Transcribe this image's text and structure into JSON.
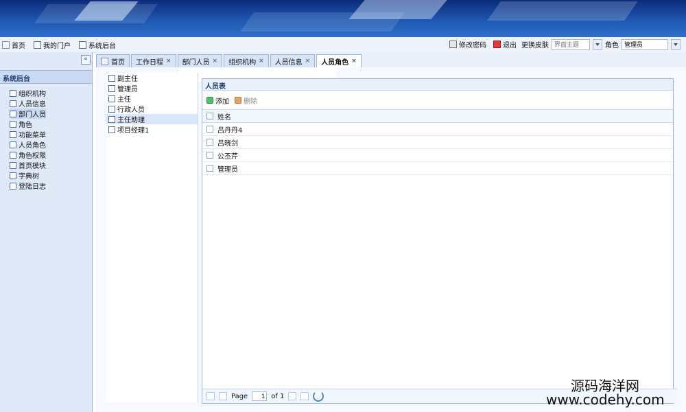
{
  "topbar": {
    "left": [
      {
        "icon": "home-icon",
        "label": "首页"
      },
      {
        "icon": "portal-icon",
        "label": "我的门户"
      },
      {
        "icon": "admin-icon",
        "label": "系统后台"
      }
    ],
    "right": {
      "change_password": "修改密码",
      "logout": "退出",
      "skin_label": "更换皮肤",
      "skin_placeholder": "界面主题",
      "role_label": "角色",
      "role_value": "管理员"
    }
  },
  "leftnav": {
    "collapse_symbol": "«",
    "title": "系统后台",
    "items": [
      {
        "label": "组织机构"
      },
      {
        "label": "人员信息"
      },
      {
        "label": "部门人员"
      },
      {
        "label": "角色"
      },
      {
        "label": "功能菜单"
      },
      {
        "label": "人员角色"
      },
      {
        "label": "角色权限"
      },
      {
        "label": "首页模块"
      },
      {
        "label": "字典树"
      },
      {
        "label": "登陆日志"
      }
    ]
  },
  "tabs": [
    {
      "label": "首页"
    },
    {
      "label": "工作日程"
    },
    {
      "label": "部门人员"
    },
    {
      "label": "组织机构"
    },
    {
      "label": "人员信息"
    },
    {
      "label": "人员角色",
      "active": true
    }
  ],
  "tree": {
    "items": [
      {
        "label": "副主任"
      },
      {
        "label": "管理员"
      },
      {
        "label": "主任"
      },
      {
        "label": "行政人员"
      },
      {
        "label": "主任助理",
        "active": true
      },
      {
        "label": "项目经理1"
      }
    ]
  },
  "grid": {
    "panel_title": "人员表",
    "toolbar": {
      "add_label": "添加",
      "delete_label": "删除"
    },
    "columns": [
      {
        "label": "姓名"
      }
    ],
    "rows": [
      {
        "name": "吕丹丹4"
      },
      {
        "name": "吕晓剑"
      },
      {
        "name": "公丕芹"
      },
      {
        "name": "管理员"
      }
    ],
    "pager": {
      "page_label": "Page",
      "page_value": "1",
      "of_label": "of 1"
    }
  },
  "watermark": {
    "line1": "源码海洋网",
    "line2": "www.codehy.com"
  }
}
